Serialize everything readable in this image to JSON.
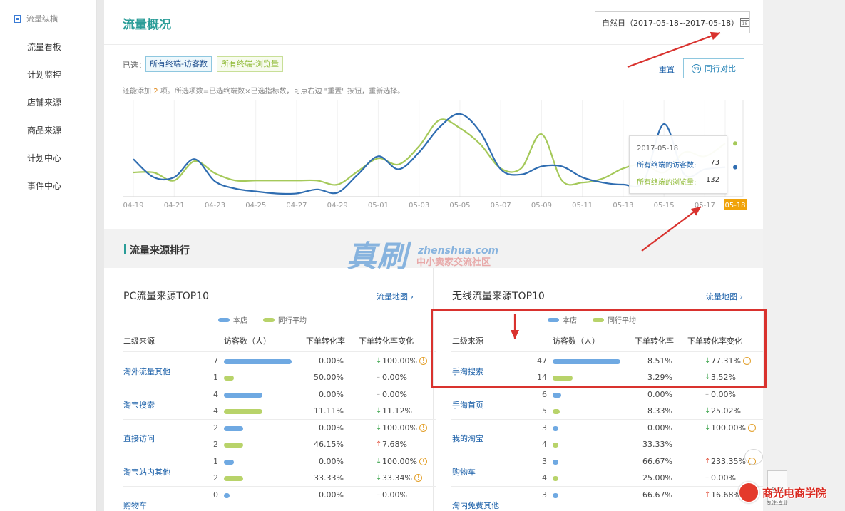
{
  "sidebar": {
    "header": "流量纵横",
    "items": [
      "流量看板",
      "计划监控",
      "店铺来源",
      "商品来源",
      "计划中心",
      "事件中心"
    ]
  },
  "header": {
    "title": "流量概况",
    "date_range": "自然日（2017-05-18~2017-05-18）",
    "calendar_day": "18"
  },
  "chart_controls": {
    "selected_label": "已选：",
    "tags": [
      "所有终端-访客数",
      "所有终端-浏览量"
    ],
    "hint_prefix": "还能添加",
    "hint_count": "2",
    "hint_suffix": "项。所选项数=已选终端数×已选指标数，可点右边 \"重置\" 按钮，重新选择。",
    "reset": "重置",
    "compare": "同行对比"
  },
  "chart_data": {
    "type": "line",
    "x": [
      "04-19",
      "04-20",
      "04-21",
      "04-22",
      "04-23",
      "04-24",
      "04-25",
      "04-26",
      "04-27",
      "04-28",
      "04-29",
      "04-30",
      "05-01",
      "05-02",
      "05-03",
      "05-04",
      "05-05",
      "05-06",
      "05-07",
      "05-08",
      "05-09",
      "05-10",
      "05-11",
      "05-12",
      "05-13",
      "05-14",
      "05-15",
      "05-16",
      "05-17",
      "05-18"
    ],
    "x_tick_labels": [
      "04-19",
      "04-21",
      "04-23",
      "04-25",
      "04-27",
      "04-29",
      "05-01",
      "05-03",
      "05-05",
      "05-07",
      "05-09",
      "05-11",
      "05-13",
      "05-15",
      "05-17",
      "05-18"
    ],
    "highlighted_x": "05-18",
    "series": [
      {
        "name": "所有终端的访客数",
        "color": "#2f6db1",
        "values": [
          93,
          48,
          48,
          93,
          38,
          20,
          13,
          8,
          8,
          18,
          10,
          55,
          100,
          68,
          110,
          172,
          205,
          160,
          68,
          55,
          75,
          75,
          48,
          35,
          30,
          38,
          180,
          55,
          68,
          73
        ]
      },
      {
        "name": "所有终端的浏览量",
        "color": "#a5c95a",
        "values": [
          60,
          60,
          40,
          88,
          58,
          40,
          40,
          40,
          40,
          40,
          30,
          63,
          95,
          80,
          125,
          190,
          170,
          130,
          70,
          70,
          155,
          40,
          35,
          45,
          70,
          80,
          60,
          110,
          100,
          132
        ]
      }
    ],
    "ylim": [
      0,
      240
    ],
    "grid": "vertical",
    "tooltip": {
      "date": "2017-05-18",
      "rows": [
        {
          "label": "所有终端的访客数:",
          "value": "73"
        },
        {
          "label": "所有终端的浏览量:",
          "value": "132"
        }
      ]
    }
  },
  "section": {
    "title": "流量来源排行",
    "watermark_main": "真刷",
    "watermark_url": "zhenshua.com",
    "watermark_sub": "中小卖家交流社区"
  },
  "legend": {
    "own": "本店",
    "peer": "同行平均"
  },
  "columns": [
    "二级来源",
    "访客数（人）",
    "下单转化率",
    "下单转化率变化"
  ],
  "pc": {
    "title": "PC流量来源TOP10",
    "map_link": "流量地图",
    "rows": [
      {
        "name": "淘外流量其他",
        "own": {
          "count": "7",
          "rate": "0.00%",
          "change": "100.00%",
          "dir": "down",
          "warn": true
        },
        "peer": {
          "count": "1",
          "rate": "50.00%",
          "change": "0.00%",
          "dir": "flat",
          "warn": false
        }
      },
      {
        "name": "淘宝搜索",
        "own": {
          "count": "4",
          "rate": "0.00%",
          "change": "0.00%",
          "dir": "flat",
          "warn": false
        },
        "peer": {
          "count": "4",
          "rate": "11.11%",
          "change": "11.12%",
          "dir": "down",
          "warn": false
        }
      },
      {
        "name": "直接访问",
        "own": {
          "count": "2",
          "rate": "0.00%",
          "change": "100.00%",
          "dir": "down",
          "warn": true
        },
        "peer": {
          "count": "2",
          "rate": "46.15%",
          "change": "7.68%",
          "dir": "up",
          "warn": false
        }
      },
      {
        "name": "淘宝站内其他",
        "own": {
          "count": "1",
          "rate": "0.00%",
          "change": "100.00%",
          "dir": "down",
          "warn": true
        },
        "peer": {
          "count": "2",
          "rate": "33.33%",
          "change": "33.34%",
          "dir": "down",
          "warn": true
        }
      },
      {
        "name": "购物车",
        "own": {
          "count": "0",
          "rate": "0.00%",
          "change": "0.00%",
          "dir": "flat",
          "warn": false
        }
      }
    ]
  },
  "mobile": {
    "title": "无线流量来源TOP10",
    "map_link": "流量地图",
    "rows": [
      {
        "name": "手淘搜索",
        "own": {
          "count": "47",
          "rate": "8.51%",
          "change": "77.31%",
          "dir": "down",
          "warn": true
        },
        "peer": {
          "count": "14",
          "rate": "3.29%",
          "change": "3.52%",
          "dir": "down",
          "warn": false
        }
      },
      {
        "name": "手淘首页",
        "own": {
          "count": "6",
          "rate": "0.00%",
          "change": "0.00%",
          "dir": "flat",
          "warn": false
        },
        "peer": {
          "count": "5",
          "rate": "8.33%",
          "change": "25.02%",
          "dir": "down",
          "warn": false
        }
      },
      {
        "name": "我的淘宝",
        "own": {
          "count": "3",
          "rate": "0.00%",
          "change": "100.00%",
          "dir": "down",
          "warn": true
        },
        "peer": {
          "count": "4",
          "rate": "33.33%",
          "change": "",
          "dir": "none",
          "warn": false
        }
      },
      {
        "name": "购物车",
        "own": {
          "count": "3",
          "rate": "66.67%",
          "change": "233.35%",
          "dir": "up",
          "warn": true
        },
        "peer": {
          "count": "4",
          "rate": "25.00%",
          "change": "0.00%",
          "dir": "flat",
          "warn": false
        }
      },
      {
        "name": "淘内免费其他",
        "own": {
          "count": "3",
          "rate": "66.67%",
          "change": "16.68%",
          "dir": "up",
          "warn": false
        }
      }
    ]
  },
  "corner": {
    "feedback": "反馈",
    "logo_text": "商光电商学院",
    "logo_sub": "专注·专业"
  },
  "colors": {
    "accent": "#2a9d98",
    "link": "#1a5fa8",
    "own_bar": "#6fa9e2",
    "peer_bar": "#b8d36a",
    "highlight": "#f0a30a",
    "annotation": "#d9322e"
  }
}
